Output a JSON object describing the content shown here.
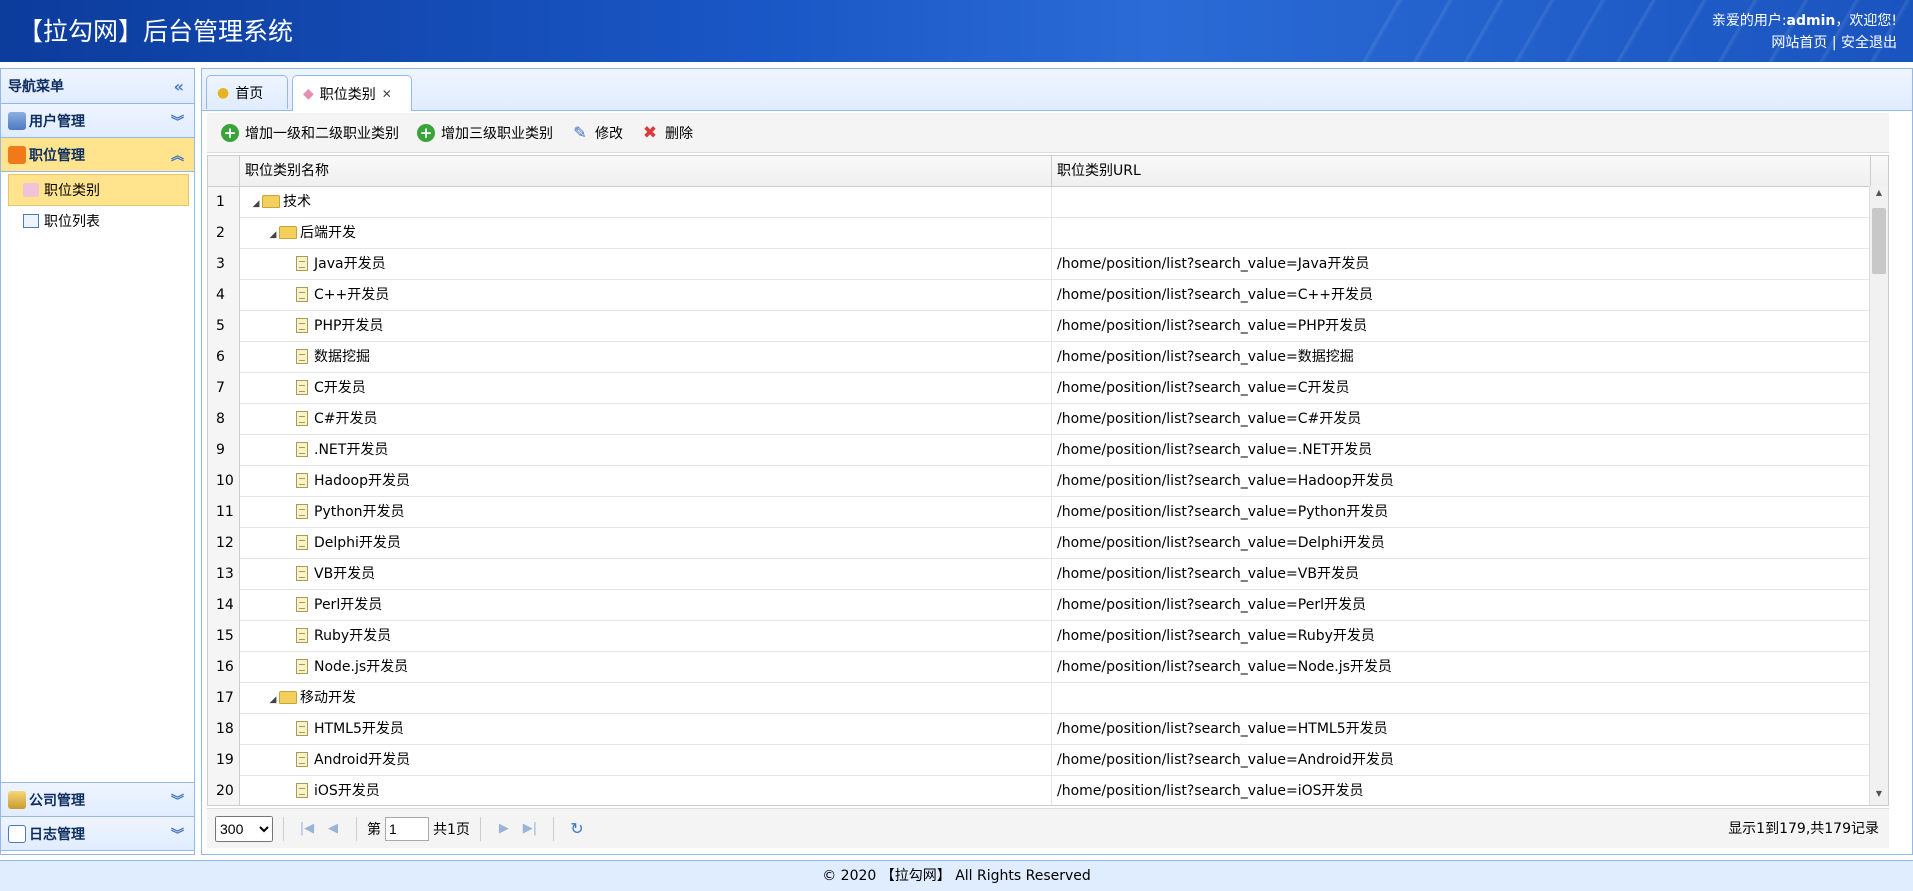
{
  "header": {
    "title": "【拉勾网】后台管理系统",
    "welcome_prefix": "亲爱的用户:",
    "username": "admin",
    "welcome_suffix": "，欢迎您!",
    "link_home": "网站首页",
    "link_sep": "|",
    "link_logout": "安全退出"
  },
  "sidebar": {
    "title": "导航菜单",
    "sections": [
      {
        "label": "用户管理",
        "icon": "users-icon",
        "state": "collapsed"
      },
      {
        "label": "职位管理",
        "icon": "rss-icon",
        "state": "expanded",
        "items": [
          {
            "label": "职位类别",
            "icon": "tag-icon",
            "selected": true
          },
          {
            "label": "职位列表",
            "icon": "list-icon",
            "selected": false
          }
        ]
      },
      {
        "label": "公司管理",
        "icon": "home-icon",
        "state": "collapsed"
      },
      {
        "label": "日志管理",
        "icon": "log-icon",
        "state": "collapsed"
      }
    ]
  },
  "tabs": [
    {
      "label": "首页",
      "icon": "bulb-icon"
    },
    {
      "label": "职位类别",
      "icon": "tag-icon",
      "closable": true
    }
  ],
  "toolbar": {
    "add12": "增加一级和二级职业类别",
    "add3": "增加三级职业类别",
    "edit": "修改",
    "delete": "删除"
  },
  "grid": {
    "col_name": "职位类别名称",
    "col_url": "职位类别URL",
    "rows": [
      {
        "num": "1",
        "name": "技术",
        "level": 0,
        "type": "folder",
        "url": ""
      },
      {
        "num": "2",
        "name": "后端开发",
        "level": 1,
        "type": "folder",
        "url": ""
      },
      {
        "num": "3",
        "name": "Java开发员",
        "level": 2,
        "type": "file",
        "url": "/home/position/list?search_value=Java开发员"
      },
      {
        "num": "4",
        "name": "C++开发员",
        "level": 2,
        "type": "file",
        "url": "/home/position/list?search_value=C++开发员"
      },
      {
        "num": "5",
        "name": "PHP开发员",
        "level": 2,
        "type": "file",
        "url": "/home/position/list?search_value=PHP开发员"
      },
      {
        "num": "6",
        "name": "数据挖掘",
        "level": 2,
        "type": "file",
        "url": "/home/position/list?search_value=数据挖掘"
      },
      {
        "num": "7",
        "name": "C开发员",
        "level": 2,
        "type": "file",
        "url": "/home/position/list?search_value=C开发员"
      },
      {
        "num": "8",
        "name": "C#开发员",
        "level": 2,
        "type": "file",
        "url": "/home/position/list?search_value=C#开发员"
      },
      {
        "num": "9",
        "name": ".NET开发员",
        "level": 2,
        "type": "file",
        "url": "/home/position/list?search_value=.NET开发员"
      },
      {
        "num": "10",
        "name": "Hadoop开发员",
        "level": 2,
        "type": "file",
        "url": "/home/position/list?search_value=Hadoop开发员"
      },
      {
        "num": "11",
        "name": "Python开发员",
        "level": 2,
        "type": "file",
        "url": "/home/position/list?search_value=Python开发员"
      },
      {
        "num": "12",
        "name": "Delphi开发员",
        "level": 2,
        "type": "file",
        "url": "/home/position/list?search_value=Delphi开发员"
      },
      {
        "num": "13",
        "name": "VB开发员",
        "level": 2,
        "type": "file",
        "url": "/home/position/list?search_value=VB开发员"
      },
      {
        "num": "14",
        "name": "Perl开发员",
        "level": 2,
        "type": "file",
        "url": "/home/position/list?search_value=Perl开发员"
      },
      {
        "num": "15",
        "name": "Ruby开发员",
        "level": 2,
        "type": "file",
        "url": "/home/position/list?search_value=Ruby开发员"
      },
      {
        "num": "16",
        "name": "Node.js开发员",
        "level": 2,
        "type": "file",
        "url": "/home/position/list?search_value=Node.js开发员"
      },
      {
        "num": "17",
        "name": "移动开发",
        "level": 1,
        "type": "folder",
        "url": ""
      },
      {
        "num": "18",
        "name": "HTML5开发员",
        "level": 2,
        "type": "file",
        "url": "/home/position/list?search_value=HTML5开发员"
      },
      {
        "num": "19",
        "name": "Android开发员",
        "level": 2,
        "type": "file",
        "url": "/home/position/list?search_value=Android开发员"
      },
      {
        "num": "20",
        "name": "iOS开发员",
        "level": 2,
        "type": "file",
        "url": "/home/position/list?search_value=iOS开发员"
      }
    ]
  },
  "pager": {
    "page_size": "300",
    "page_prefix": "第",
    "page_value": "1",
    "page_total": "共1页",
    "info": "显示1到179,共179记录"
  },
  "footer": {
    "text": "© 2020 【拉勾网】 All Rights Reserved"
  }
}
